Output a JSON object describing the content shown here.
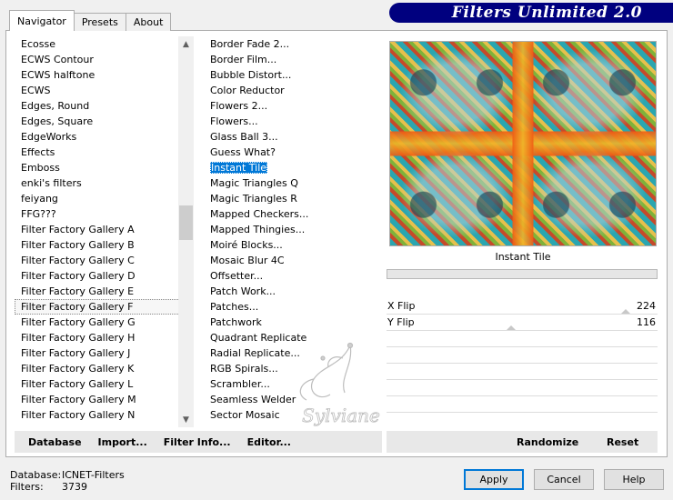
{
  "banner": {
    "title": "Filters Unlimited 2.0"
  },
  "tabs": [
    {
      "label": "Navigator",
      "active": true
    },
    {
      "label": "Presets",
      "active": false
    },
    {
      "label": "About",
      "active": false
    }
  ],
  "categories": [
    "Ecosse",
    "ECWS Contour",
    "ECWS halftone",
    "ECWS",
    "Edges, Round",
    "Edges, Square",
    "EdgeWorks",
    "Effects",
    "Emboss",
    "enki's filters",
    "feiyang",
    "FFG???",
    "Filter Factory Gallery A",
    "Filter Factory Gallery B",
    "Filter Factory Gallery C",
    "Filter Factory Gallery D",
    "Filter Factory Gallery E",
    "Filter Factory Gallery F",
    "Filter Factory Gallery G",
    "Filter Factory Gallery H",
    "Filter Factory Gallery J",
    "Filter Factory Gallery K",
    "Filter Factory Gallery L",
    "Filter Factory Gallery M",
    "Filter Factory Gallery N"
  ],
  "selected_category": "Filter Factory Gallery F",
  "filters": [
    "Border Fade 2...",
    "Border Film...",
    "Bubble Distort...",
    "Color Reductor",
    "Flowers 2...",
    "Flowers...",
    "Glass Ball 3...",
    "Guess What?",
    "Instant Tile",
    "Magic Triangles Q",
    "Magic Triangles R",
    "Mapped Checkers...",
    "Mapped Thingies...",
    "Moiré Blocks...",
    "Mosaic Blur 4C",
    "Offsetter...",
    "Patch Work...",
    "Patches...",
    "Patchwork",
    "Quadrant Replicate",
    "Radial Replicate...",
    "RGB Spirals...",
    "Scrambler...",
    "Seamless Welder",
    "Sector Mosaic"
  ],
  "selected_filter": "Instant Tile",
  "preview": {
    "filter_name": "Instant Tile"
  },
  "sliders": [
    {
      "label": "X Flip",
      "value": "224",
      "level": 224
    },
    {
      "label": "Y Flip",
      "value": "116",
      "level": 116
    }
  ],
  "watermark": {
    "text": "Sylviane"
  },
  "buttons_left": {
    "database": "Database",
    "import": "Import...",
    "filter_info": "Filter Info...",
    "editor": "Editor..."
  },
  "buttons_right": {
    "randomize": "Randomize",
    "reset": "Reset"
  },
  "info": {
    "database_label": "Database:",
    "database_value": "ICNET-Filters",
    "filters_label": "Filters:",
    "filters_value": "3739"
  },
  "dialog": {
    "apply": "Apply",
    "cancel": "Cancel",
    "help": "Help"
  },
  "colors": {
    "banner": "#00007f",
    "selection": "#0078d7"
  }
}
